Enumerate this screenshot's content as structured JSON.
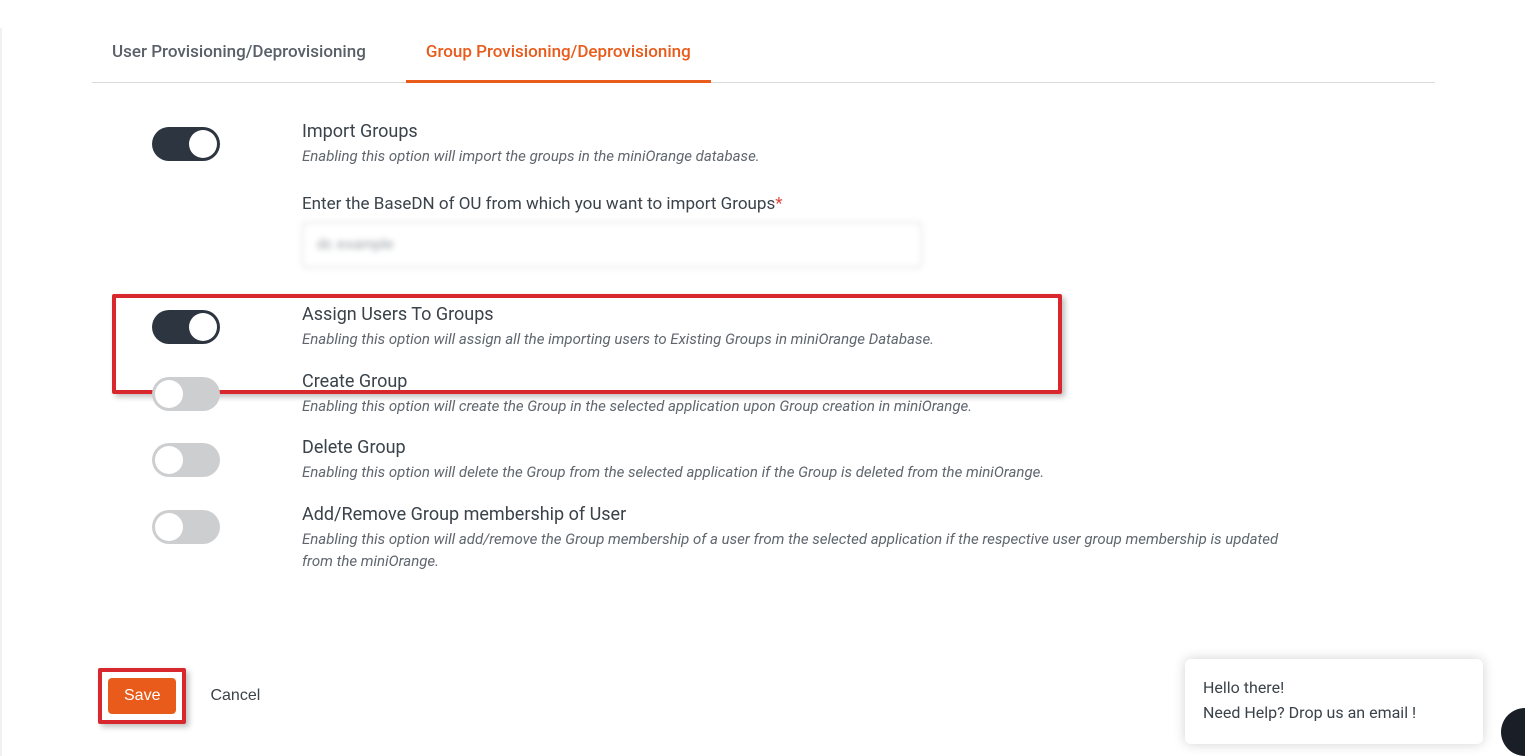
{
  "tabs": {
    "user": "User Provisioning/Deprovisioning",
    "group": "Group Provisioning/Deprovisioning"
  },
  "options": {
    "import": {
      "title": "Import Groups",
      "desc": "Enabling this option will import the groups in the miniOrange database.",
      "on": true
    },
    "basedn": {
      "label": "Enter the BaseDN of OU from which you want to import Groups",
      "value": "dc example"
    },
    "assign": {
      "title": "Assign Users To Groups",
      "desc": "Enabling this option will assign all the importing users to Existing Groups in miniOrange Database.",
      "on": true
    },
    "create": {
      "title": "Create Group",
      "desc": "Enabling this option will create the Group in the selected application upon Group creation in miniOrange.",
      "on": false
    },
    "delete": {
      "title": "Delete Group",
      "desc": "Enabling this option will delete the Group from the selected application if the Group is deleted from the miniOrange.",
      "on": false
    },
    "membership": {
      "title": "Add/Remove Group membership of User",
      "desc": "Enabling this option will add/remove the Group membership of a user from the selected application if the respective user group membership is updated from the miniOrange.",
      "on": false
    }
  },
  "buttons": {
    "save": "Save",
    "cancel": "Cancel"
  },
  "help": {
    "line1": "Hello there!",
    "line2": "Need Help? Drop us an email !"
  }
}
